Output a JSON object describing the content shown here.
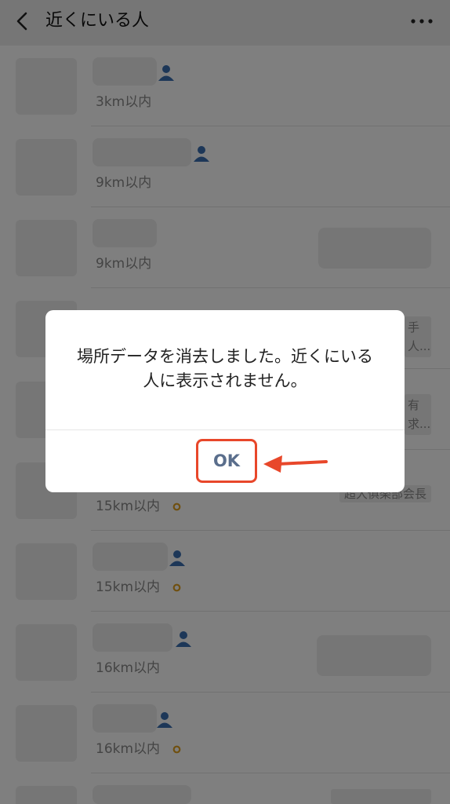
{
  "header": {
    "back_icon": "chevron-left-icon",
    "title": "近くにいる人",
    "more_icon": "more-horizontal-icon"
  },
  "rows": [
    {
      "distance": "3km以内"
    },
    {
      "distance": "9km以内"
    },
    {
      "distance": "9km以内"
    },
    {
      "tag_line1": "手",
      "tag_line2": "人..."
    },
    {
      "tag_line1": "有",
      "tag_line2": "求..."
    },
    {
      "distance": "15km以内",
      "tag": "超大俱楽部会長"
    },
    {
      "distance": "15km以内"
    },
    {
      "distance": "16km以内"
    },
    {
      "distance": "16km以内"
    },
    {}
  ],
  "dialog": {
    "message": "場所データを消去しました。近くにいる人に表示されません。",
    "ok_label": "OK"
  },
  "colors": {
    "highlight": "#e8472a",
    "user_icon": "#3a6fb0",
    "ok_text": "#5a6e8c"
  }
}
